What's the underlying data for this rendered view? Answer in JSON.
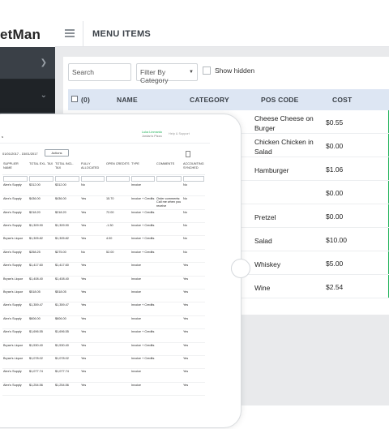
{
  "app": {
    "logo_text": "etMan",
    "page_title": "MENU ITEMS"
  },
  "filters": {
    "search_placeholder": "Search",
    "category_label": "Filter By Category",
    "show_hidden_label": "Show hidden"
  },
  "menu_table": {
    "headers": [
      "(0)",
      "NAME",
      "CATEGORY",
      "POS CODE",
      "COST"
    ],
    "rows": [
      {
        "name": "Cheese Cheese on Burger",
        "cost": "$0.55"
      },
      {
        "name": "Chicken Chicken in Salad",
        "cost": "$0.00"
      },
      {
        "name": "Hamburger",
        "cost": "$1.06"
      },
      {
        "name": "",
        "cost": "$0.00"
      },
      {
        "name": "Pretzel",
        "cost": "$0.00"
      },
      {
        "name": "Salad",
        "cost": "$10.00"
      },
      {
        "name": "Whiskey",
        "cost": "$5.00"
      },
      {
        "name": "Wine",
        "cost": "$2.54"
      }
    ]
  },
  "tablet": {
    "title_mark": "s",
    "user_name": "Luka Linmardo",
    "shop_name": "Jordan's Pizza",
    "help_label": "Help & Support",
    "date_range": "01/01/2017 - 15/01/2017",
    "actions_label": "Actions",
    "headers": [
      "SUPPLIER NAME",
      "TOTAL EXL. TAX",
      "TOTAL INCL. TAX",
      "FULLY ALLOCATED",
      "OPEN CREDITS",
      "TYPE",
      "COMMENTS",
      "ACCOUNTING SYNCHED"
    ],
    "rows": [
      [
        "Alex's Supply",
        "$312.00",
        "$312.00",
        "No",
        "",
        "Invoice",
        "",
        "No"
      ],
      [
        "Alex's Supply",
        "$436.00",
        "$436.00",
        "Yes",
        "15.70",
        "Invoice + Credits",
        "Order comments: Call me when you receive",
        "No"
      ],
      [
        "Alex's Supply",
        "$218.20",
        "$218.20",
        "Yes",
        "72.00",
        "Invoice + Credits",
        "",
        "No"
      ],
      [
        "Alex's Supply",
        "$1,309.90",
        "$1,309.90",
        "Yes",
        "-1.30",
        "Invoice + Credits",
        "",
        "No"
      ],
      [
        "Bryan's Liquor",
        "$1,305.82",
        "$1,305.82",
        "Yes",
        "4.00",
        "Invoice + Credits",
        "",
        "No"
      ],
      [
        "Alex's Supply",
        "$258.25",
        "$275.00",
        "No",
        "52.00",
        "Invoice + Credits",
        "",
        "No"
      ],
      [
        "Alex's Supply",
        "$1,417.60",
        "$1,417.60",
        "Yes",
        "",
        "Invoice",
        "",
        "Yes"
      ],
      [
        "Bryan's Liquor",
        "$1,408.40",
        "$1,408.40",
        "Yes",
        "",
        "Invoice",
        "",
        "Yes"
      ],
      [
        "Bryan's Liquor",
        "$518.05",
        "$518.05",
        "Yes",
        "",
        "Invoice",
        "",
        "Yes"
      ],
      [
        "Alex's Supply",
        "$1,359.47",
        "$1,359.47",
        "Yes",
        "",
        "Invoice + Credits",
        "",
        "Yes"
      ],
      [
        "Alex's Supply",
        "$606.00",
        "$606.00",
        "Yes",
        "",
        "Invoice",
        "",
        "Yes"
      ],
      [
        "Alex's Supply",
        "$1,696.55",
        "$1,696.55",
        "Yes",
        "",
        "Invoice + Credits",
        "",
        "Yes"
      ],
      [
        "Bryan's Liquor",
        "$1,530.40",
        "$1,530.40",
        "Yes",
        "",
        "Invoice + Credits",
        "",
        "Yes"
      ],
      [
        "Bryan's Liquor",
        "$1,078.02",
        "$1,078.02",
        "Yes",
        "",
        "Invoice + Credits",
        "",
        "Yes"
      ],
      [
        "Alex's Supply",
        "$1,077.74",
        "$1,077.74",
        "Yes",
        "",
        "Invoice",
        "",
        "Yes"
      ],
      [
        "Alex's Supply",
        "$1,254.56",
        "$1,254.56",
        "Yes",
        "",
        "Invoice",
        "",
        "Yes"
      ]
    ]
  }
}
